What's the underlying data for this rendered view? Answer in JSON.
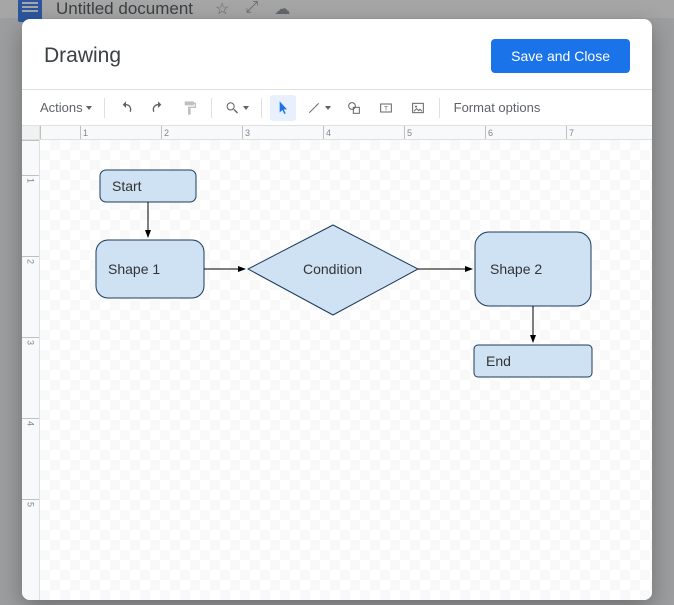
{
  "docs": {
    "title": "Untitled document"
  },
  "modal": {
    "title": "Drawing",
    "save_label": "Save and Close"
  },
  "toolbar": {
    "actions_label": "Actions",
    "format_options": "Format options"
  },
  "ruler": {
    "h": [
      "1",
      "2",
      "3",
      "4",
      "5",
      "6",
      "7"
    ],
    "v": [
      "1",
      "2",
      "3",
      "4",
      "5"
    ]
  },
  "shapes": {
    "start": "Start",
    "shape1": "Shape 1",
    "condition": "Condition",
    "shape2": "Shape 2",
    "end": "End"
  }
}
